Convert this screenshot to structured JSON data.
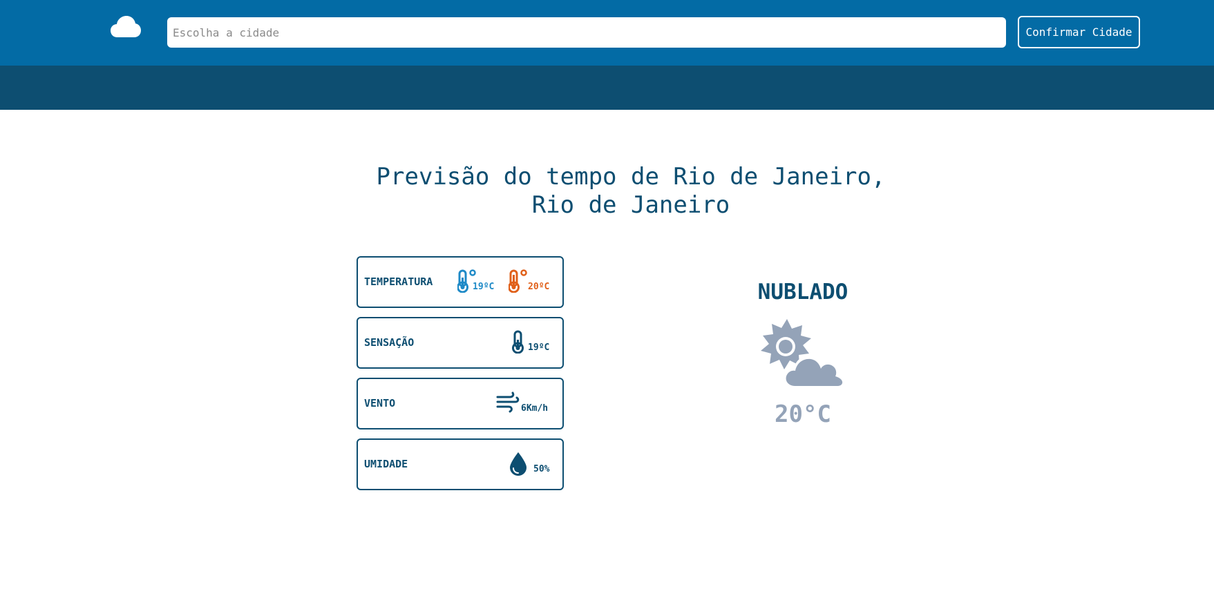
{
  "header": {
    "logo_icon": "cloud-icon",
    "search": {
      "placeholder": "Escolha a cidade",
      "value": ""
    },
    "confirm_label": "Confirmar Cidade"
  },
  "main": {
    "title_line1": "Previsão do tempo de Rio de Janeiro,",
    "title_line2": "Rio de Janeiro",
    "cards": {
      "temperature": {
        "label": "TEMPERATURA",
        "min": "19ºC",
        "max": "20ºC"
      },
      "feels_like": {
        "label": "SENSAÇÃO",
        "value": "19ºC"
      },
      "wind": {
        "label": "VENTO",
        "value": "6Km/h"
      },
      "humidity": {
        "label": "UMIDADE",
        "value": "50%"
      }
    },
    "condition": {
      "label": "NUBLADO",
      "icon": "partly-cloudy-icon",
      "temperature": "20°C"
    }
  },
  "colors": {
    "header": "#036ba5",
    "subheader": "#0d4e71",
    "primary_text": "#0d4e71",
    "cold": "#1f8ac7",
    "hot": "#e0601a",
    "muted": "#94a3b8"
  }
}
